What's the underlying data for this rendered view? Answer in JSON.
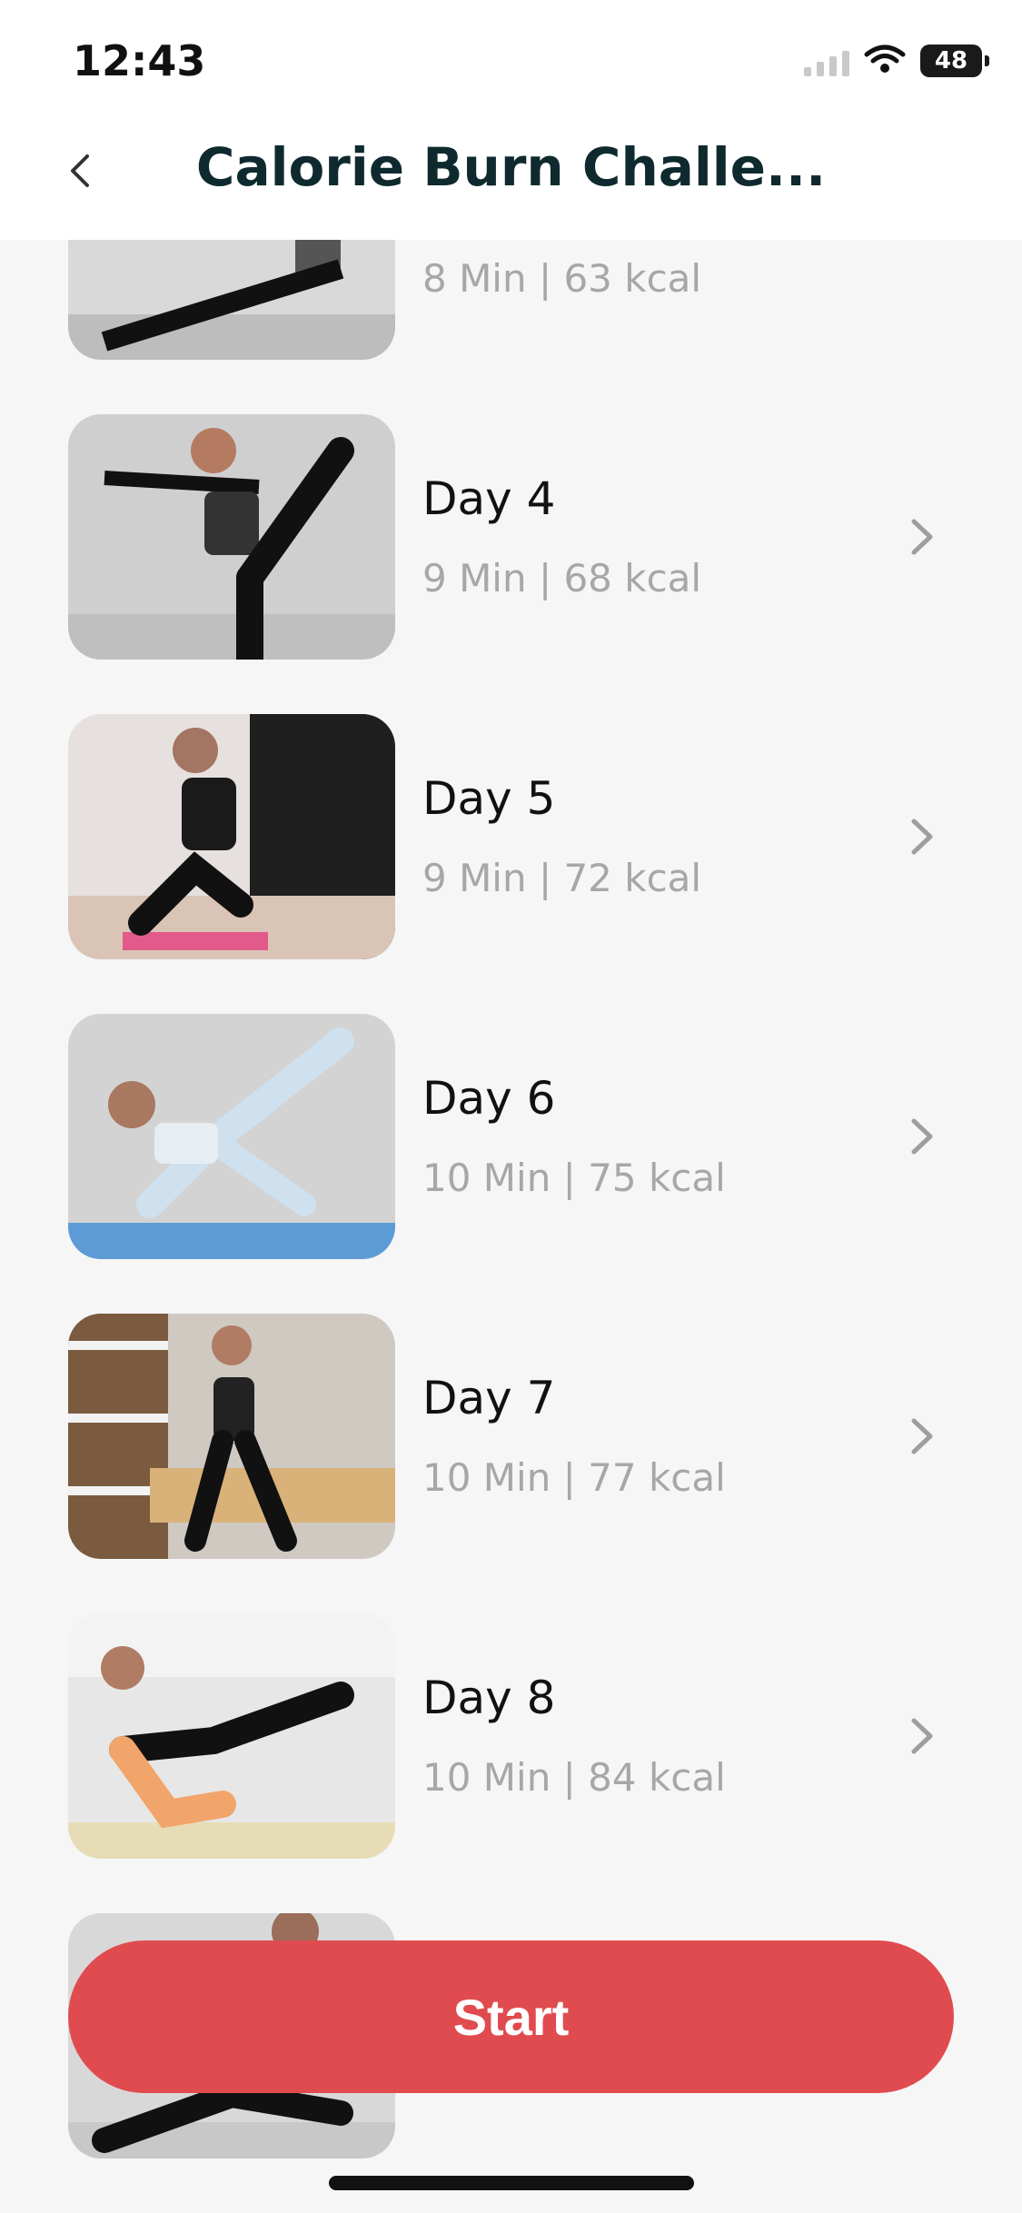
{
  "status_bar": {
    "time": "12:43",
    "battery": "48"
  },
  "header": {
    "title": "Calorie Burn Challe..."
  },
  "list": {
    "items": [
      {
        "day": "",
        "meta": "8 Min | 63 kcal",
        "thumb_bg": "#d9d9d9"
      },
      {
        "day": "Day 4",
        "meta": "9 Min | 68 kcal",
        "thumb_bg": "#cfcfcf"
      },
      {
        "day": "Day 5",
        "meta": "9 Min | 72 kcal",
        "thumb_bg": "#e6e0de"
      },
      {
        "day": "Day 6",
        "meta": "10 Min | 75 kcal",
        "thumb_bg": "#d3d3d3"
      },
      {
        "day": "Day 7",
        "meta": "10 Min | 77 kcal",
        "thumb_bg": "#cfc9c2"
      },
      {
        "day": "Day 8",
        "meta": "10 Min | 84 kcal",
        "thumb_bg": "#e7e7e7"
      },
      {
        "day": "",
        "meta": "",
        "thumb_bg": "#d8d8d8"
      }
    ]
  },
  "start_button": {
    "label": "Start"
  },
  "colors": {
    "accent": "#e04b4f",
    "title": "#0f2a2f",
    "meta": "#a7a7a7"
  }
}
